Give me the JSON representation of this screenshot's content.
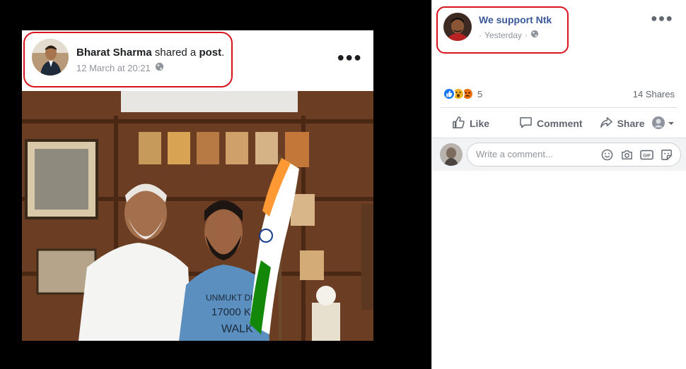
{
  "shared_post": {
    "author": "Bharat Sharma",
    "shared_text": "shared a",
    "post_word": "post",
    "punctuation": ".",
    "timestamp": "12 March at 20:21",
    "flag_text": "UNMUKT DIWA 17000 KM WALK"
  },
  "post": {
    "page_name": "We support Ntk",
    "timestamp": "Yesterday",
    "separator": "·",
    "reaction_count": "5",
    "shares": "14 Shares"
  },
  "actions": {
    "like": "Like",
    "comment": "Comment",
    "share": "Share"
  },
  "comment_box": {
    "placeholder": "Write a comment...",
    "gif_label": "GIF"
  },
  "colors": {
    "highlight": "#d8131c",
    "link": "#385898",
    "like_blue": "#1877f2"
  },
  "icons": [
    "globe-icon",
    "more-options-icon",
    "like-reaction-icon",
    "wow-reaction-icon",
    "angry-reaction-icon",
    "thumbs-up-icon",
    "comment-icon",
    "share-icon",
    "chevron-down-icon",
    "emoji-icon",
    "camera-icon",
    "gif-icon",
    "sticker-icon"
  ]
}
